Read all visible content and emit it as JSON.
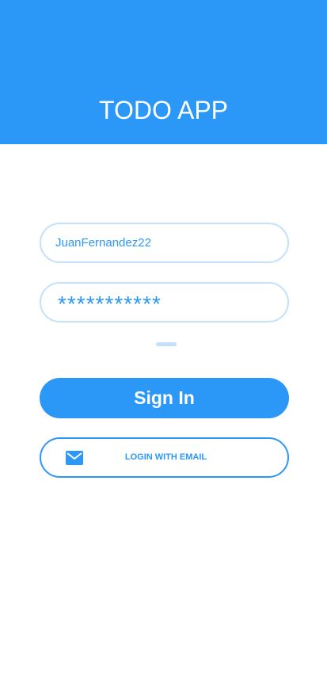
{
  "header": {
    "title": "TODO APP"
  },
  "login_form": {
    "username_value": "JuanFernandez22",
    "password_masked": "***********",
    "signin_label": "Sign In",
    "email_login_label": "LOGIN WITH EMAIL",
    "email_icon": "mail-icon"
  },
  "colors": {
    "primary": "#2b97f7",
    "field_border": "#c3e1fb",
    "background": "#ffffff"
  }
}
